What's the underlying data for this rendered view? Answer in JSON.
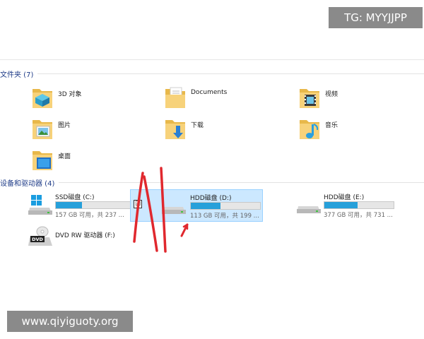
{
  "watermarks": {
    "top": "TG: MYYJJPP",
    "bottom": "www.qiyiguoty.org"
  },
  "folders_group": {
    "header": "文件夹 (7)",
    "items": [
      {
        "label": "3D 对象",
        "icon": "3d-objects-folder-icon"
      },
      {
        "label": "Documents",
        "icon": "documents-folder-icon"
      },
      {
        "label": "视频",
        "icon": "videos-folder-icon"
      },
      {
        "label": "图片",
        "icon": "pictures-folder-icon"
      },
      {
        "label": "下载",
        "icon": "downloads-folder-icon"
      },
      {
        "label": "音乐",
        "icon": "music-folder-icon"
      },
      {
        "label": "桌面",
        "icon": "desktop-folder-icon"
      }
    ]
  },
  "drives_group": {
    "header": "设备和驱动器 (4)",
    "items": [
      {
        "name": "SSD磁盘 (C:)",
        "free": "157 GB 可用，共 237 ...",
        "used_fraction": 0.34,
        "icon": "windows-drive-icon"
      },
      {
        "name": "HDD磁盘 (D:)",
        "free": "113 GB 可用，共 199 ...",
        "used_fraction": 0.43,
        "icon": "hard-drive-icon",
        "selected": true,
        "checked": "☑"
      },
      {
        "name": "HDD磁盘 (E:)",
        "free": "377 GB 可用，共 731 ...",
        "used_fraction": 0.48,
        "icon": "hard-drive-icon"
      },
      {
        "name": "DVD RW 驱动器 (F:)",
        "icon": "dvd-drive-icon",
        "icon_text": "DVD"
      }
    ]
  },
  "colors": {
    "accent": "#26a0da",
    "header_text": "#1f3c88",
    "selection_bg": "#cce8ff",
    "annotation_red": "#e0282e"
  }
}
